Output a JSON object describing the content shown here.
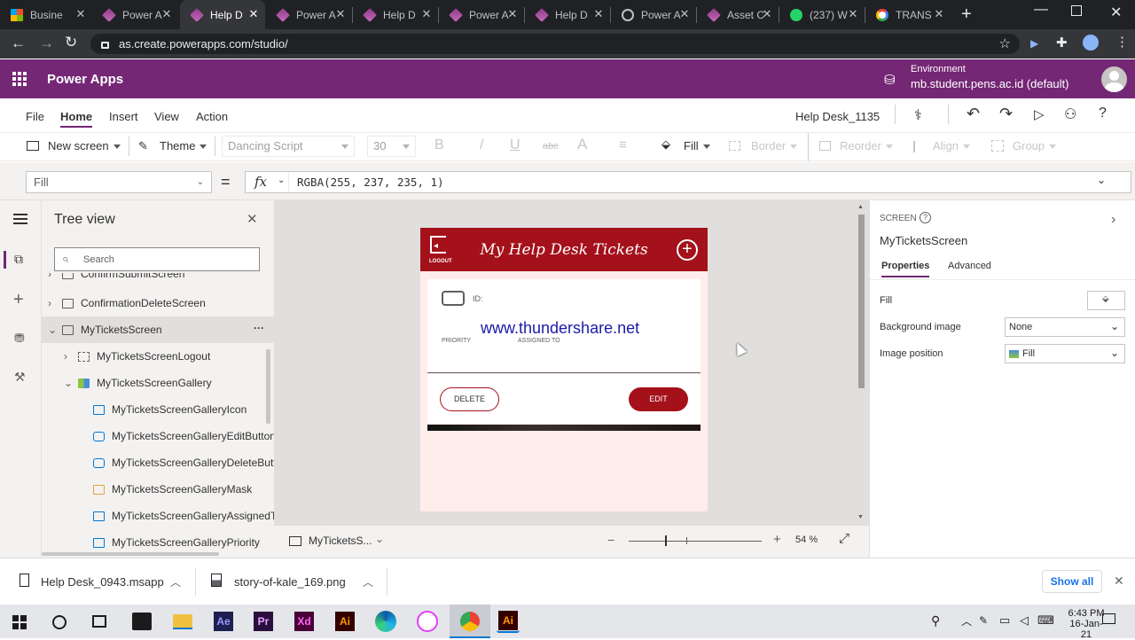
{
  "browser": {
    "tabs": [
      {
        "label": "Busine",
        "icon": "microsoft-icon"
      },
      {
        "label": "Power A",
        "icon": "powerapps-icon"
      },
      {
        "label": "Help D",
        "icon": "powerapps-icon",
        "active": true
      },
      {
        "label": "Power A",
        "icon": "powerapps-icon"
      },
      {
        "label": "Help D",
        "icon": "powerapps-icon"
      },
      {
        "label": "Power A",
        "icon": "powerapps-icon"
      },
      {
        "label": "Help D",
        "icon": "powerapps-icon"
      },
      {
        "label": "Power A",
        "icon": "globe-icon"
      },
      {
        "label": "Asset C",
        "icon": "powerapps-icon"
      },
      {
        "label": "(237) W",
        "icon": "whatsapp-icon"
      },
      {
        "label": "TRANS",
        "icon": "google-icon"
      }
    ],
    "url": "as.create.powerapps.com/studio/"
  },
  "app": {
    "title": "Power Apps",
    "environment_label": "Environment",
    "environment_value": "mb.student.pens.ac.id (default)",
    "accent": "#742774"
  },
  "menu": {
    "items": [
      "File",
      "Home",
      "Insert",
      "View",
      "Action"
    ],
    "active": "Home",
    "app_name": "Help Desk_1135"
  },
  "toolbar": {
    "new_screen": "New screen",
    "theme": "Theme",
    "font": "Dancing Script",
    "font_size": "30",
    "bold": "B",
    "italic": "/",
    "underline": "U",
    "strike": "abc",
    "font_color": "A",
    "align": "≡",
    "fill": "Fill",
    "border": "Border",
    "reorder": "Reorder",
    "align_btn": "Align",
    "group": "Group"
  },
  "formula": {
    "property": "Fill",
    "equals": "=",
    "fx": "fx",
    "value": "RGBA(255, 237, 235, 1)"
  },
  "tree": {
    "title": "Tree view",
    "search_placeholder": "Search",
    "items": [
      {
        "label": "ConfirmSubmitScreen"
      },
      {
        "label": "ConfirmationDeleteScreen"
      },
      {
        "label": "MyTicketsScreen",
        "more": "···"
      },
      {
        "label": "MyTicketsScreenLogout"
      },
      {
        "label": "MyTicketsScreenGallery"
      },
      {
        "label": "MyTicketsScreenGalleryIcon"
      },
      {
        "label": "MyTicketsScreenGalleryEditButton"
      },
      {
        "label": "MyTicketsScreenGalleryDeleteButton"
      },
      {
        "label": "MyTicketsScreenGalleryMask"
      },
      {
        "label": "MyTicketsScreenGalleryAssignedTo"
      },
      {
        "label": "MyTicketsScreenGalleryPriority"
      }
    ]
  },
  "canvas": {
    "header_title": "My Help Desk Tickets",
    "logout_label": "LOGOUT",
    "id_label": "ID:",
    "watermark": "www.thundershare.net",
    "priority_label": "PRIORITY",
    "assigned_label": "ASSIGNED TO",
    "delete_label": "DELETE",
    "edit_label": "EDIT",
    "screen_selector": "MyTicketsS...",
    "zoom": "54",
    "zoom_unit": "%",
    "header_color": "#a4111b",
    "bg_color": "#ffedeb"
  },
  "properties": {
    "type_label": "SCREEN",
    "screen_name": "MyTicketsScreen",
    "tabs": [
      "Properties",
      "Advanced"
    ],
    "rows": [
      {
        "label": "Fill",
        "value": ""
      },
      {
        "label": "Background image",
        "value": "None"
      },
      {
        "label": "Image position",
        "value": "Fill"
      }
    ]
  },
  "downloads": {
    "items": [
      {
        "name": "Help Desk_0943.msapp",
        "icon": "file-icon"
      },
      {
        "name": "story-of-kale_169.png",
        "icon": "image-file-icon"
      }
    ],
    "show_all": "Show all"
  },
  "taskbar": {
    "apps": [
      {
        "name": "Ae",
        "color": "#1f1f4f",
        "text_color": "#9999ff"
      },
      {
        "name": "Pr",
        "color": "#2a0f3c",
        "text_color": "#e3a3ff"
      },
      {
        "name": "Xd",
        "color": "#470137",
        "text_color": "#ff61f6"
      },
      {
        "name": "Ai",
        "color": "#330000",
        "text_color": "#ff9a00"
      },
      {
        "name": "Ai",
        "color": "#330000",
        "text_color": "#ff9a00"
      }
    ],
    "time": "6:43 PM",
    "date": "16-Jan-21"
  }
}
